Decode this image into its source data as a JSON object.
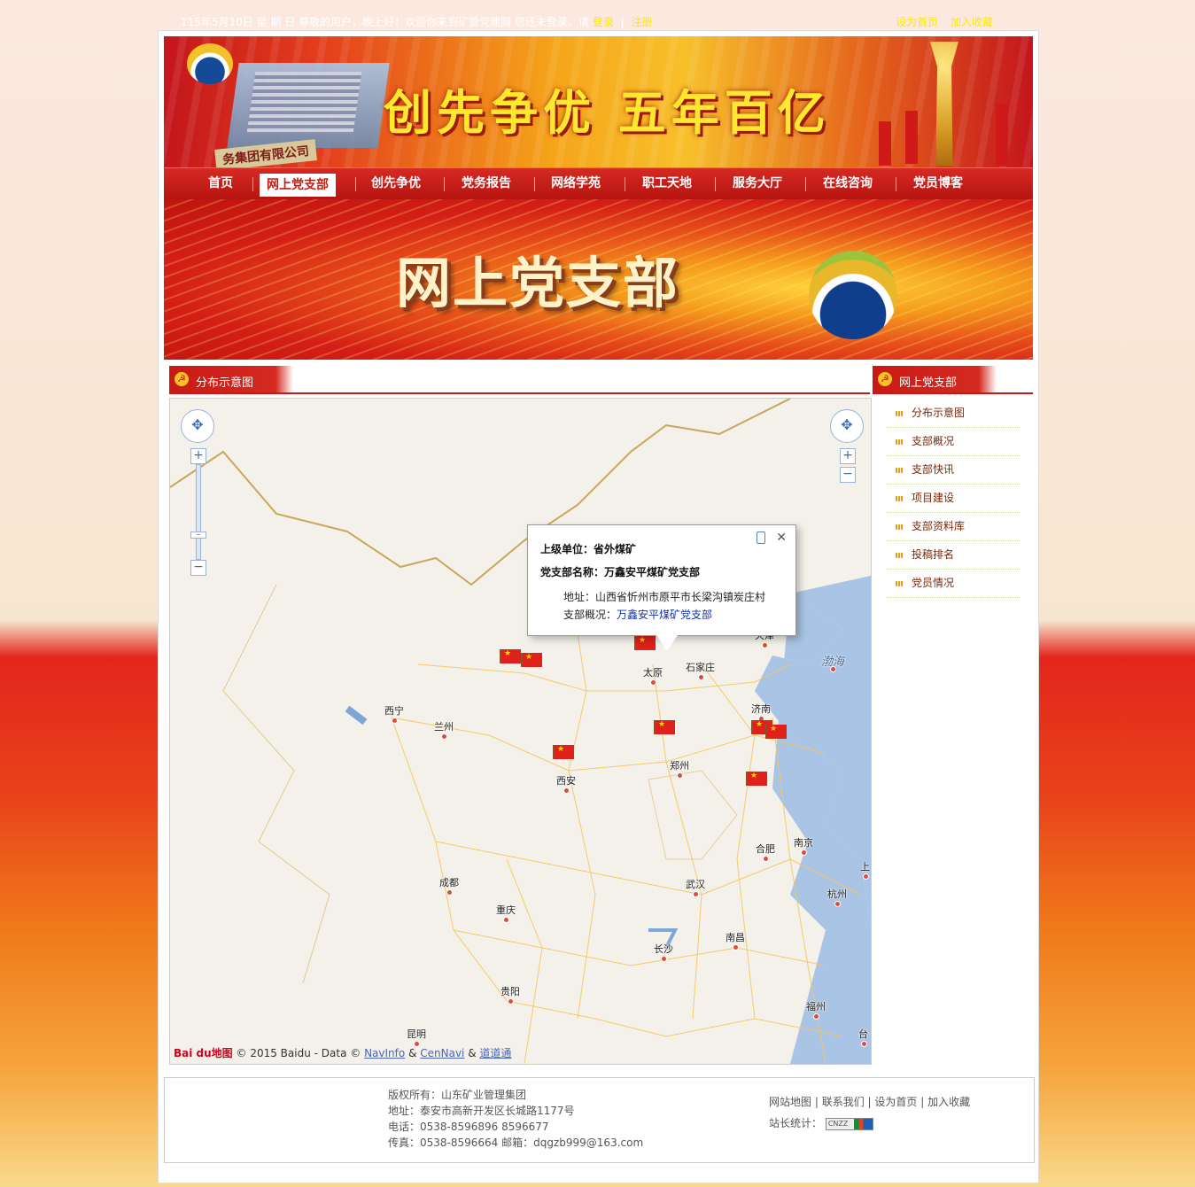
{
  "topbar": {
    "greeting": "115年5月10日 星 期 日 尊敬的用户，晚上好！欢迎你来到矿管党建网 您还未登录。请",
    "login": "登录",
    "sep": "|",
    "register": "注册",
    "set_home": "设为首页",
    "add_favorite": "加入收藏"
  },
  "header": {
    "slogan": "创先争优  五年百亿",
    "company": "务集团有限公司"
  },
  "nav": {
    "items": [
      "首页",
      "网上党支部",
      "创先争优",
      "党务报告",
      "网络学苑",
      "职工天地",
      "服务大厅",
      "在线咨询",
      "党员博客"
    ]
  },
  "banner": {
    "title": "网上党支部"
  },
  "main": {
    "section_title": "分布示意图"
  },
  "map": {
    "cities": [
      "天津",
      "太原",
      "石家庄",
      "渤海",
      "西宁",
      "兰州",
      "济南",
      "郑州",
      "西安",
      "南京",
      "合肥",
      "成都",
      "武汉",
      "重庆",
      "杭州",
      "上",
      "长沙",
      "南昌",
      "贵阳",
      "福州",
      "昆明",
      "台"
    ],
    "popup": {
      "superior_label": "上级单位：",
      "superior": "省外煤矿",
      "branch_label": "党支部名称：",
      "branch": "万鑫安平煤矿党支部",
      "address_label": "地址：",
      "address": "山西省忻州市原平市长梁沟镇炭庄村",
      "overview_label": "支部概况：",
      "overview": "万鑫安平煤矿党支部"
    },
    "copyright": {
      "logo": "Bai du地图",
      "text": "© 2015 Baidu - Data ©",
      "navinfo": "NavInfo",
      "amp1": "&",
      "cennavi": "CenNavi",
      "amp2": "&",
      "daodaotong": "道道通"
    }
  },
  "sidebar": {
    "title": "网上党支部",
    "items": [
      "分布示意图",
      "支部概况",
      "支部快讯",
      "项目建设",
      "支部资料库",
      "投稿排名",
      "党员情况"
    ]
  },
  "footer": {
    "copyright": "版权所有：山东矿业管理集团",
    "address": "地址：泰安市高新开发区长城路1177号",
    "phone": "电话：0538-8596896  8596677",
    "fax": "传真：0538-8596664 邮箱：dqgzb999@163.com",
    "links": [
      "网站地图",
      "联系我们",
      "设为首页",
      "加入收藏"
    ],
    "stat_label": "站长统计：",
    "badge": "CNZZ"
  },
  "colors": {
    "brand_red": "#c81a14",
    "link_yellow": "#ffe900",
    "nav_red": "#d62a24"
  }
}
